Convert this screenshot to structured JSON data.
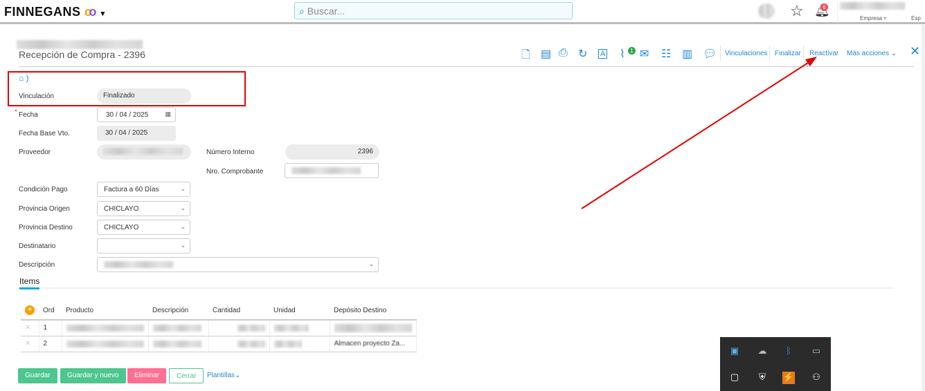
{
  "header": {
    "logo": "FINNEGANS",
    "search_placeholder": "Buscar...",
    "notifications_count": "6",
    "company_label": "Empresa ▿",
    "extra": "Esp"
  },
  "page": {
    "title": "Recepción de Compra - 2396"
  },
  "toolbar": {
    "links": [
      "Vinculaciones",
      "Finalizar",
      "Reactivar",
      "Más acciones"
    ],
    "attachments_count": "1"
  },
  "form": {
    "vinculacion": {
      "label": "Vinculación",
      "value": "Finalizado"
    },
    "fecha": {
      "label": "Fecha",
      "value": "30 / 04 / 2025"
    },
    "fecha_base": {
      "label": "Fecha Base Vto.",
      "value": "30 / 04 / 2025"
    },
    "proveedor": {
      "label": "Proveedor"
    },
    "numero_interno": {
      "label": "Número Interno",
      "value": "2396"
    },
    "nro_comprobante": {
      "label": "Nro. Comprobante"
    },
    "condicion_pago": {
      "label": "Condición Pago",
      "value": "Factura a 60 Días"
    },
    "provincia_origen": {
      "label": "Provincia Origen",
      "value": "CHICLAYO"
    },
    "provincia_destino": {
      "label": "Provincia Destino",
      "value": "CHICLAYO"
    },
    "destinatario": {
      "label": "Destinatario",
      "value": ""
    },
    "descripcion": {
      "label": "Descripción"
    }
  },
  "items": {
    "tab": "Items",
    "columns": [
      "Ord",
      "Producto",
      "Descripción",
      "Cantidad",
      "Unidad",
      "Depósito Destino"
    ],
    "rows": [
      {
        "ord": "1",
        "deposito": ""
      },
      {
        "ord": "2",
        "deposito": "Almacen proyecto Za..."
      }
    ]
  },
  "buttons": {
    "guardar": "Guardar",
    "guardar_nuevo": "Guardar y nuevo",
    "eliminar": "Eliminar",
    "cerrar": "Cerrar",
    "plantillas": "Plantillas"
  },
  "colors": {
    "accent": "#1e88d4",
    "green": "#4dc690",
    "pink": "#ff6f91",
    "annotation": "#e30000"
  }
}
